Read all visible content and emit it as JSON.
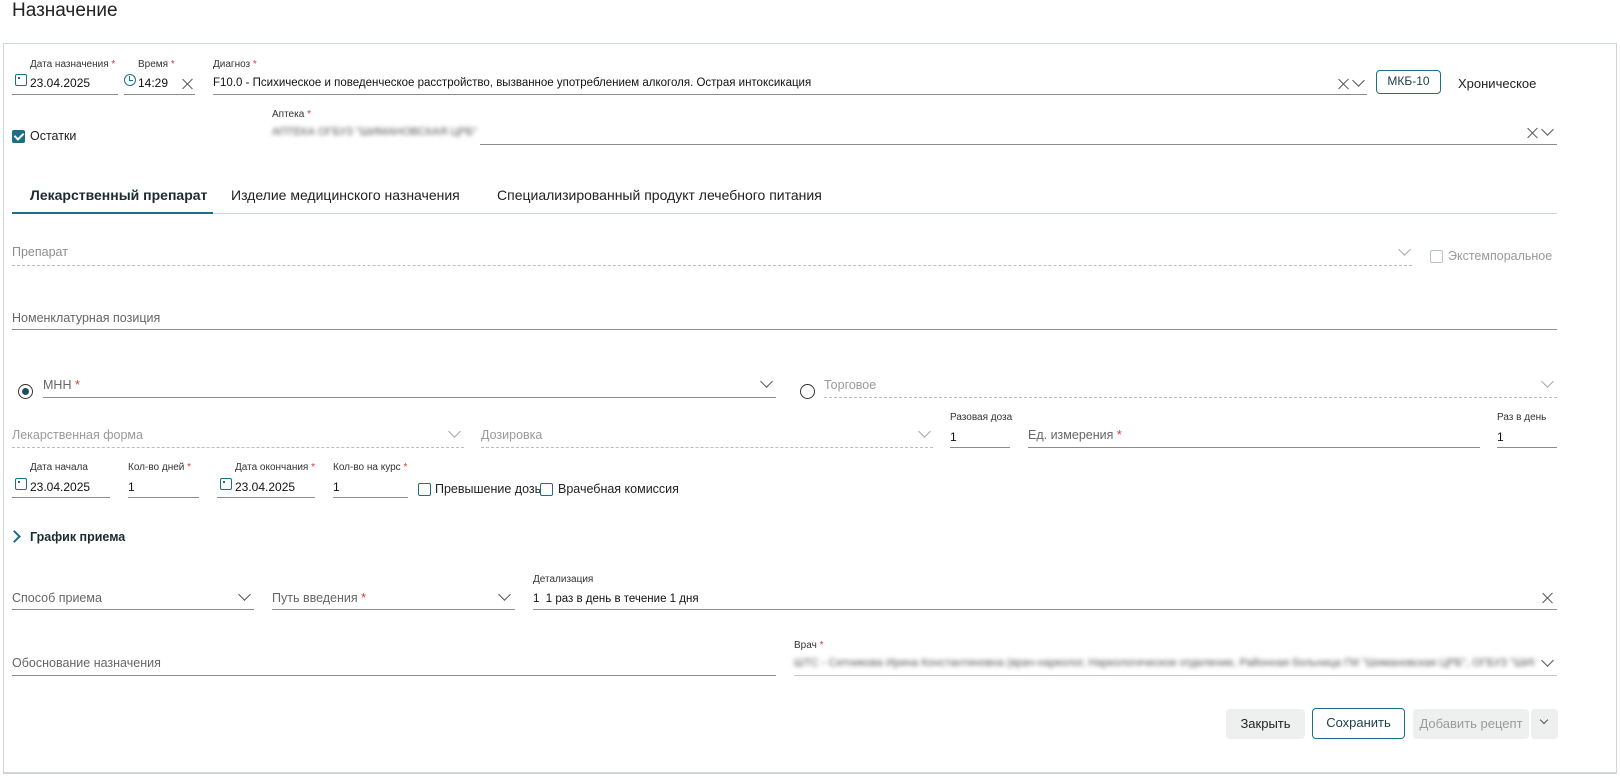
{
  "header": {
    "title": "Назначение"
  },
  "top": {
    "date_label": "Дата назначения",
    "date_value": "23.04.2025",
    "time_label": "Время",
    "time_value": "14:29",
    "diagnosis_label": "Диагноз",
    "diagnosis_value": "F10.0 - Психическое и поведенческое расстройство, вызванное употреблением алкоголя. Острая интоксикация",
    "mkb_button": "МКБ-10",
    "chronic_label": "Хроническое",
    "remains_label": "Остатки",
    "pharmacy_label": "Аптека",
    "pharmacy_value": "АПТЕКА ОГБУЗ \"ШИМАНОВСКАЯ ЦРБ\""
  },
  "tabs": [
    {
      "label": "Лекарственный препарат",
      "active": true
    },
    {
      "label": "Изделие медицинского назначения",
      "active": false
    },
    {
      "label": "Специализированный продукт лечебного питания",
      "active": false
    }
  ],
  "form": {
    "drug_placeholder": "Препарат",
    "extemp_label": "Экстемпоральное",
    "nomenclature_placeholder": "Номенклатурная позиция",
    "mnn_label": "МНН",
    "trade_label": "Торговое",
    "dosage_form_placeholder": "Лекарственная форма",
    "dosage_placeholder": "Дозировка",
    "single_dose_label": "Разовая доза",
    "single_dose_value": "1",
    "unit_placeholder": "Ед. измерения",
    "times_per_day_label": "Раз в день",
    "times_per_day_value": "1",
    "start_date_label": "Дата начала",
    "start_date_value": "23.04.2025",
    "days_label": "Кол-во дней",
    "days_value": "1",
    "end_date_label": "Дата окончания",
    "end_date_value": "23.04.2025",
    "course_label": "Кол-во на курс",
    "course_value": "1",
    "overdose_label": "Превышение дозы",
    "commission_label": "Врачебная комиссия",
    "schedule_label": "График приема",
    "method_placeholder": "Способ приема",
    "route_placeholder": "Путь введения",
    "detail_label": "Детализация",
    "detail_value": "1  1 раз в день в течение 1 дня",
    "justification_placeholder": "Обоснование назначения",
    "doctor_label": "Врач",
    "doctor_value": "ШТС - Ситникова Ирина Константиновна (врач-нарколог, Наркологическое отделение, Районная больница ГМ \"Шимановская ЦРБ\", ОГБУЗ \"ШИМАНОВСКАЯ ЦРБ\")"
  },
  "footer": {
    "close_button": "Закрыть",
    "save_button": "Сохранить",
    "add_recipe_button": "Добавить рецепт"
  },
  "colors": {
    "accent": "#1b6f86",
    "required": "#d13a3a"
  }
}
